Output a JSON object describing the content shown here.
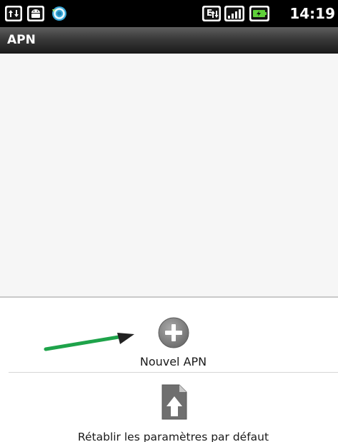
{
  "status_bar": {
    "time": "14:19",
    "left_icons": [
      "usb-data-transfer-icon",
      "android-debug-icon",
      "sync-icon"
    ],
    "right_icons": [
      "network-type-e-icon",
      "signal-strength-icon",
      "battery-icon"
    ]
  },
  "title_bar": {
    "title": "APN"
  },
  "options_menu": {
    "items": [
      {
        "label": "Nouvel APN",
        "icon": "add-icon"
      },
      {
        "label": "Rétablir les paramètres par défaut",
        "icon": "reset-icon"
      }
    ]
  },
  "annotation": {
    "arrow_color": "#1ea34a"
  },
  "colors": {
    "status_bar": "#000000",
    "title_bar": "#2e2e2e",
    "background": "#f6f6f6",
    "menu_icon": "#7a7a7a"
  }
}
